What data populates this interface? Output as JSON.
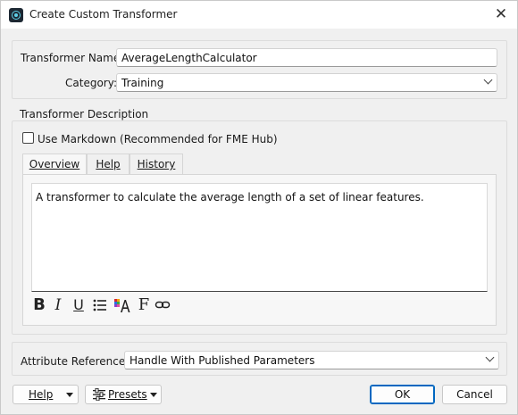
{
  "window": {
    "title": "Create Custom Transformer",
    "close_glyph": "✕"
  },
  "general": {
    "name_label": "Transformer Name:",
    "name_value": "AverageLengthCalculator",
    "category_label": "Category:",
    "category_value": "Training"
  },
  "description": {
    "group_label": "Transformer Description",
    "markdown_checkbox_label": "Use Markdown (Recommended for FME Hub)",
    "markdown_checked": false,
    "tabs": [
      {
        "label": "Overview",
        "active": true
      },
      {
        "label": "Help",
        "active": false
      },
      {
        "label": "History",
        "active": false
      }
    ],
    "overview_text": "A transformer to calculate the average length of a set of linear features.",
    "toolbar_icons": [
      "bold-icon",
      "italic-icon",
      "underline-icon",
      "bulleted-list-icon",
      "text-color-icon",
      "font-icon",
      "link-icon"
    ]
  },
  "attributes": {
    "label": "Attribute References:",
    "value": "Handle With Published Parameters"
  },
  "footer": {
    "help_label": "Help",
    "presets_label": "Presets",
    "ok_label": "OK",
    "cancel_label": "Cancel"
  },
  "colors": {
    "accent": "#0067c0",
    "background": "#f0f0f0"
  }
}
